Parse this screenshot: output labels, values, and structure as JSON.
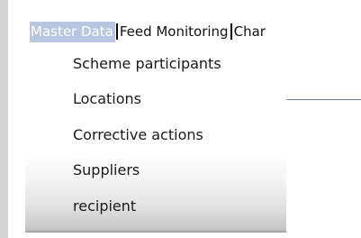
{
  "menubar": {
    "items": [
      {
        "label": "Master Data"
      },
      {
        "label": "Feed Monitoring"
      },
      {
        "label": "Char"
      }
    ]
  },
  "dropdown": {
    "items": [
      {
        "label": "Scheme participants"
      },
      {
        "label": "Locations"
      },
      {
        "label": "Corrective actions"
      },
      {
        "label": "Suppliers"
      },
      {
        "label": "recipient"
      }
    ]
  }
}
